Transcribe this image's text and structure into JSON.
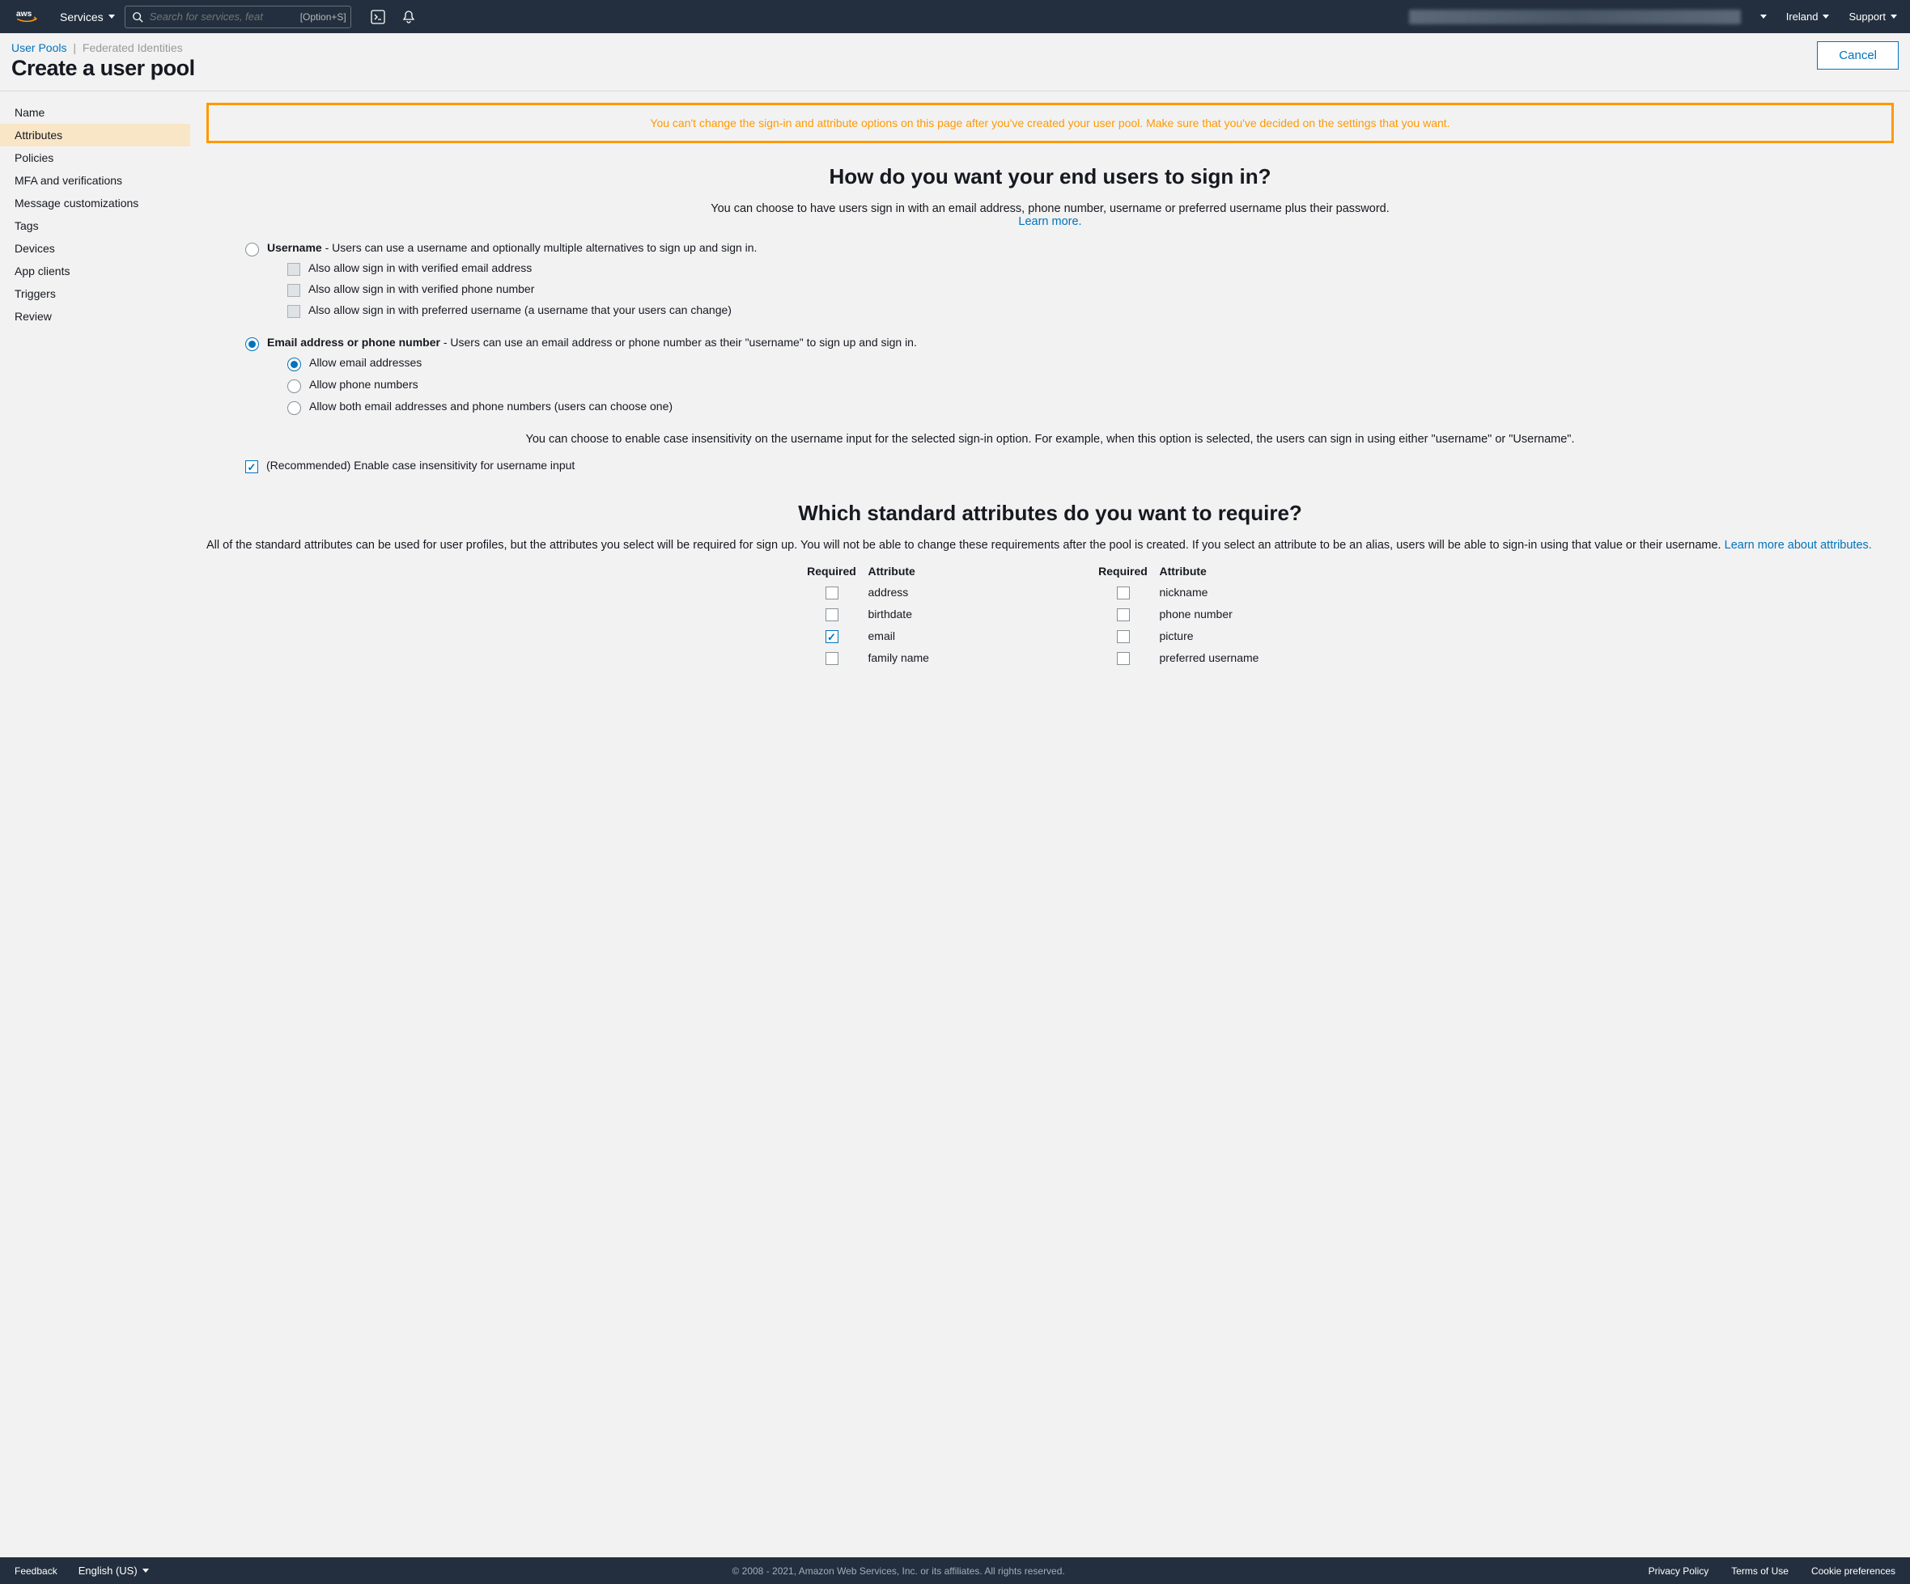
{
  "nav": {
    "services_label": "Services",
    "search_placeholder": "Search for services, feat",
    "search_shortcut": "[Option+S]",
    "region": "Ireland",
    "support_label": "Support"
  },
  "breadcrumb": {
    "user_pools": "User Pools",
    "federated": "Federated Identities"
  },
  "page_title": "Create a user pool",
  "cancel_label": "Cancel",
  "sidenav": {
    "items": [
      "Name",
      "Attributes",
      "Policies",
      "MFA and verifications",
      "Message customizations",
      "Tags",
      "Devices",
      "App clients",
      "Triggers",
      "Review"
    ],
    "active_index": 1
  },
  "banner": "You can't change the sign-in and attribute options on this page after you've created your user pool. Make sure that you've decided on the settings that you want.",
  "signin": {
    "heading": "How do you want your end users to sign in?",
    "desc": "You can choose to have users sign in with an email address, phone number, username or preferred username plus their password.",
    "learn_more": "Learn more.",
    "username_label_bold": "Username",
    "username_label_rest": " - Users can use a username and optionally multiple alternatives to sign up and sign in.",
    "username_subs": [
      "Also allow sign in with verified email address",
      "Also allow sign in with verified phone number",
      "Also allow sign in with preferred username (a username that your users can change)"
    ],
    "email_label_bold": "Email address or phone number",
    "email_label_rest": " - Users can use an email address or phone number as their \"username\" to sign up and sign in.",
    "email_subs": [
      "Allow email addresses",
      "Allow phone numbers",
      "Allow both email addresses and phone numbers (users can choose one)"
    ],
    "email_sub_selected_index": 0,
    "case_desc": "You can choose to enable case insensitivity on the username input for the selected sign-in option. For example, when this option is selected, the users can sign in using either \"username\" or \"Username\".",
    "case_label": "(Recommended) Enable case insensitivity for username input"
  },
  "attributes": {
    "heading": "Which standard attributes do you want to require?",
    "desc_1": "All of the standard attributes can be used for user profiles, but the attributes you select will be required for sign up. You will not be able to change these requirements after the pool is created. If you select an attribute to be an alias, users will be able to sign-in using that value or their username. ",
    "learn_more": "Learn more about attributes.",
    "col_required": "Required",
    "col_attribute": "Attribute",
    "left": [
      {
        "label": "address",
        "checked": false
      },
      {
        "label": "birthdate",
        "checked": false
      },
      {
        "label": "email",
        "checked": true
      },
      {
        "label": "family name",
        "checked": false
      }
    ],
    "right": [
      {
        "label": "nickname",
        "checked": false
      },
      {
        "label": "phone number",
        "checked": false
      },
      {
        "label": "picture",
        "checked": false
      },
      {
        "label": "preferred username",
        "checked": false
      }
    ]
  },
  "footer": {
    "feedback": "Feedback",
    "language": "English (US)",
    "copyright": "© 2008 - 2021, Amazon Web Services, Inc. or its affiliates. All rights reserved.",
    "privacy": "Privacy Policy",
    "terms": "Terms of Use",
    "cookie": "Cookie preferences"
  }
}
